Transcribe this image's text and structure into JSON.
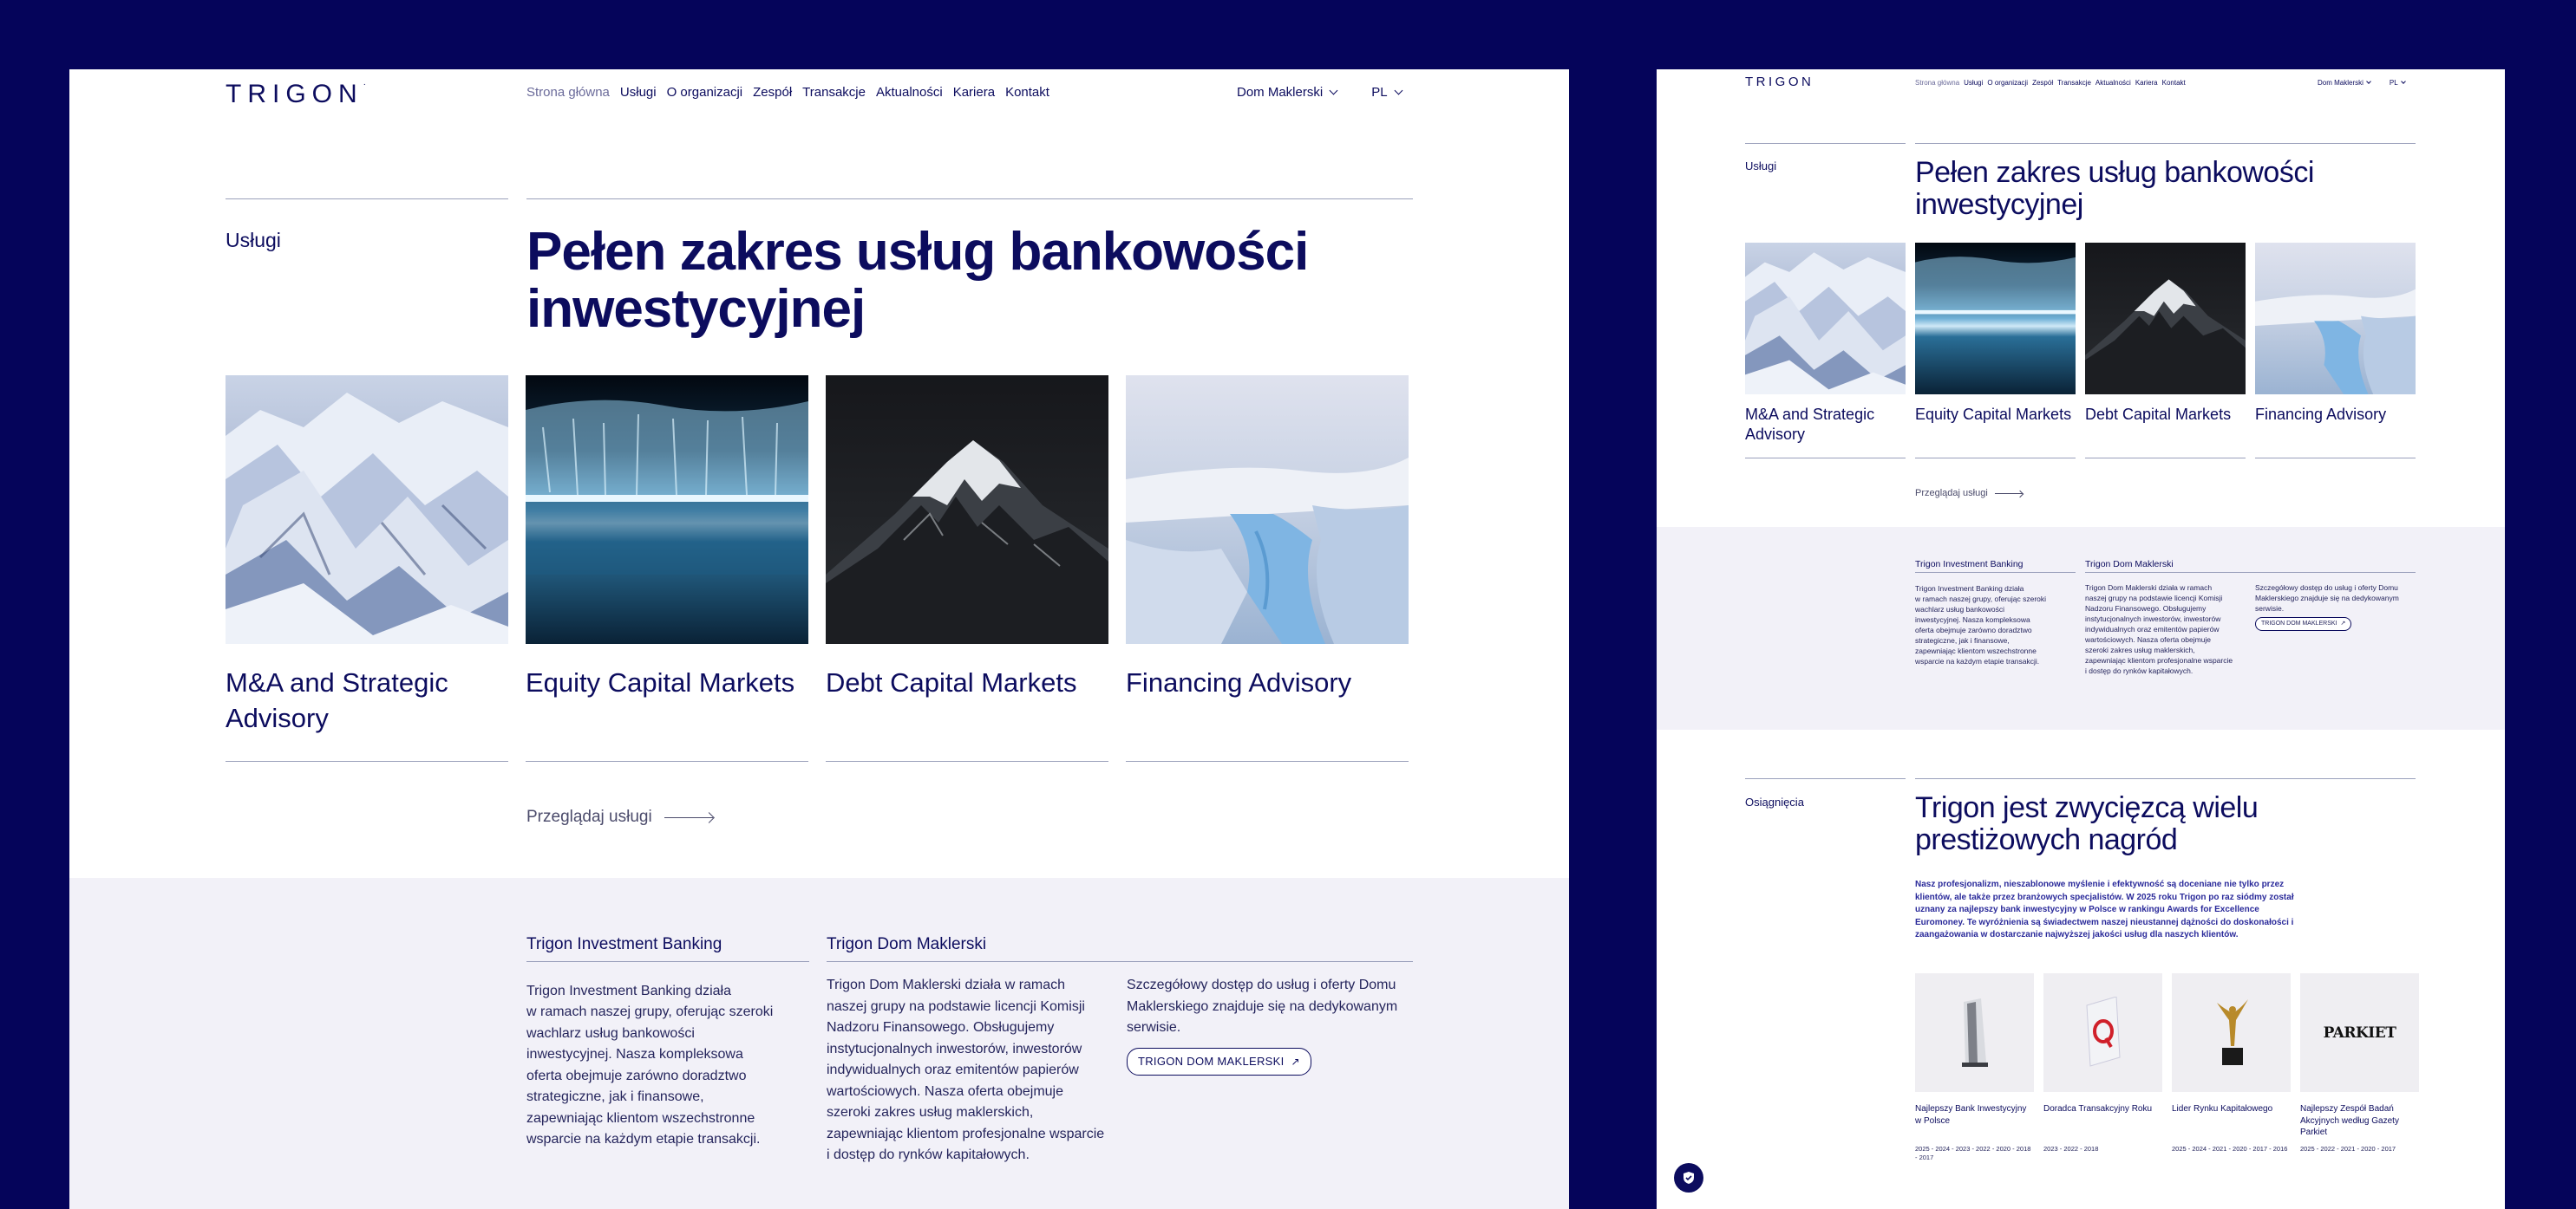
{
  "brand": {
    "logo": "TRIGON"
  },
  "nav": {
    "items": [
      "Strona główna",
      "Usługi",
      "O organizacji",
      "Zespół",
      "Transakcje",
      "Aktualności",
      "Kariera",
      "Kontakt"
    ],
    "dropdown": "Dom Maklerski",
    "language": "PL"
  },
  "services": {
    "section_label": "Usługi",
    "title": "Pełen zakres usług bankowości inwestycyjnej",
    "cards": [
      {
        "title": "M&A and Strategic Advisory",
        "image": "snowy-mountain-range"
      },
      {
        "title": "Equity Capital Markets",
        "image": "glacier-ice-wall"
      },
      {
        "title": "Debt Capital Markets",
        "image": "dark-snowy-peak"
      },
      {
        "title": "Financing Advisory",
        "image": "blue-ice-crevasse"
      }
    ],
    "browse_label": "Przeglądaj usługi"
  },
  "info": {
    "col1": {
      "heading": "Trigon Investment Banking",
      "text": "Trigon Investment Banking działa\nw ramach naszej grupy, oferując szeroki\nwachlarz usług bankowości\ninwestycyjnej. Nasza kompleksowa\noferta obejmuje zarówno doradztwo\nstrategiczne, jak i finansowe,\nzapewniając klientom wszechstronne\nwsparcie na każdym etapie transakcji."
    },
    "col2": {
      "heading": "Trigon Dom Maklerski",
      "text": "Trigon Dom Maklerski działa w ramach\nnaszej grupy na podstawie licencji Komisji\nNadzoru Finansowego. Obsługujemy\ninstytucjonalnych inwestorów, inwestorów\nindywidualnych oraz emitentów papierów\nwartościowych. Nasza oferta obejmuje\nszeroki zakres usług maklerskich,\nzapewniając klientom profesjonalne wsparcie\ni dostęp do rynków kapitałowych."
    },
    "col3": {
      "text": "Szczegółowy dostęp do usług i oferty Domu\nMaklerskiego znajduje się na dedykowanym\nserwisie.",
      "button": "TRIGON DOM MAKLERSKI"
    }
  },
  "achievements": {
    "section_label": "Osiągnięcia",
    "title": "Trigon jest zwycięzcą wielu prestiżowych nagród",
    "lead": "Nasz profesjonalizm, nieszablonowe myślenie i efektywność są doceniane nie tylko przez klientów, ale także przez branżowych specjalistów. W 2025 roku Trigon po raz siódmy został uznany za najlepszy bank inwestycyjny w Polsce w rankingu Awards for Excellence Euromoney. Te wyróżnienia są świadectwem naszej nieustannej dążności do doskonałości i zaangażowania w dostarczanie najwyższej jakości usług dla naszych klientów.",
    "awards": [
      {
        "name": "Najlepszy Bank Inwestycyjny w Polsce",
        "years": "2025 - 2024 - 2023 - 2022 - 2020 - 2018 - 2017",
        "icon": "euromoney-trophy"
      },
      {
        "name": "Doradca Transakcyjny Roku",
        "years": "2023 - 2022 - 2018",
        "icon": "red-glass-trophy"
      },
      {
        "name": "Lider Rynku Kapitałowego",
        "years": "2025 - 2024 - 2021 - 2020 - 2017 - 2016",
        "icon": "gold-figure-trophy"
      },
      {
        "name": "Najlepszy Zespół Badań Akcyjnych według Gazety Parkiet",
        "years": "2025 - 2022 - 2021 - 2020 - 2017",
        "icon": "parkiet-logo",
        "logo_text": "PARKIET"
      }
    ]
  },
  "colors": {
    "navy": "#0c0c5e",
    "background": "#05045a",
    "band": "#f2f1f8"
  }
}
